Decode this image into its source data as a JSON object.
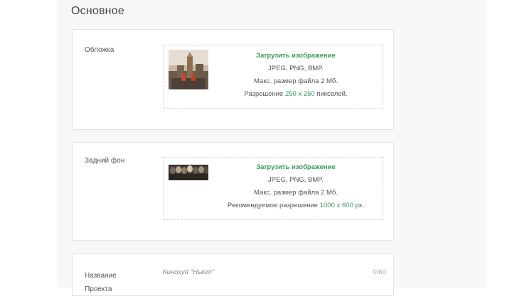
{
  "section": {
    "title": "Основное"
  },
  "cover": {
    "label": "Обложка",
    "upload_link": "Загрузить изображение",
    "formats": "JPEG, PNG, BMP.",
    "max_size": "Макс. размер файла 2 Мб.",
    "res_prefix": "Разрешение",
    "res_value": "250 x 250",
    "res_suffix": "пикселей."
  },
  "background": {
    "label": "Задний фон",
    "upload_link": "Загрузить изображение",
    "formats": "JPEG, PNG, BMP.",
    "max_size": "Макс. размер файла 2 Мб.",
    "res_prefix": "Рекомендуемое разрешение",
    "res_value": "1000 x 600",
    "res_suffix": "px."
  },
  "project_name": {
    "label": "Название Проекта",
    "placeholder": "Кинохуй \"Ньют\"",
    "counter": "0/60"
  },
  "colors": {
    "accent": "#3a9a5b"
  }
}
